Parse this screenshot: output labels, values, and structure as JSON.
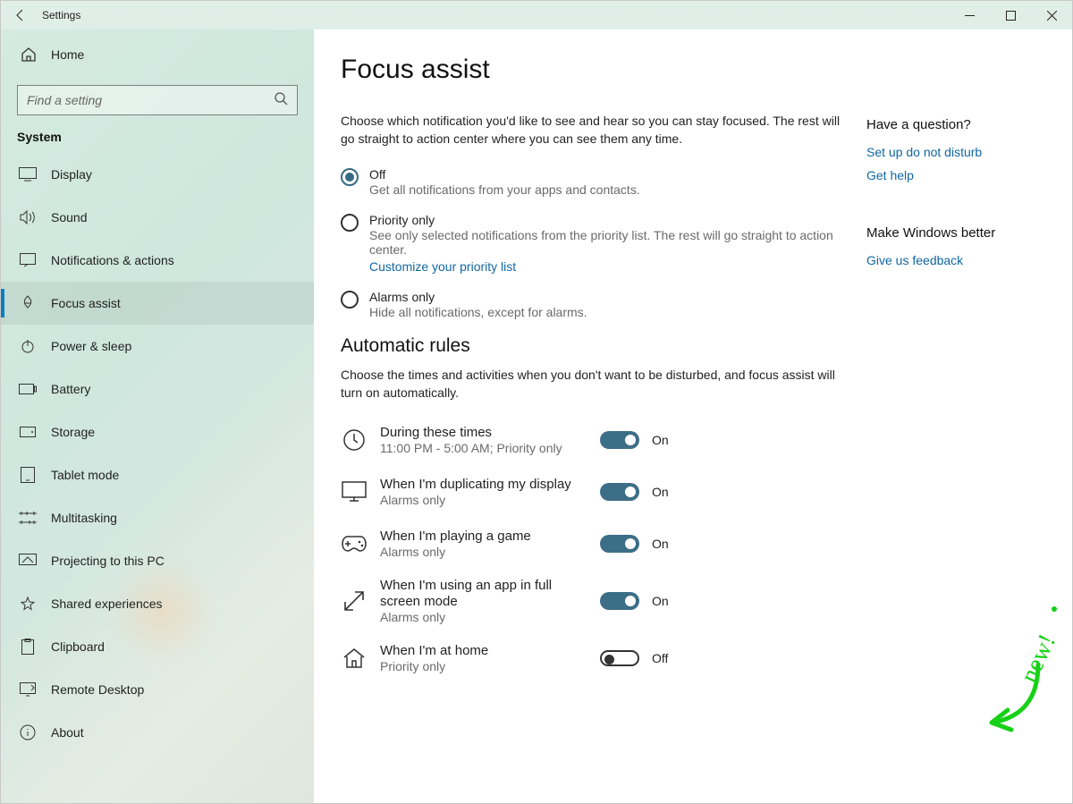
{
  "titlebar": {
    "title": "Settings"
  },
  "sidebar": {
    "home": "Home",
    "searchPlaceholder": "Find a setting",
    "section": "System",
    "items": [
      {
        "label": "Display"
      },
      {
        "label": "Sound"
      },
      {
        "label": "Notifications & actions"
      },
      {
        "label": "Focus assist"
      },
      {
        "label": "Power & sleep"
      },
      {
        "label": "Battery"
      },
      {
        "label": "Storage"
      },
      {
        "label": "Tablet mode"
      },
      {
        "label": "Multitasking"
      },
      {
        "label": "Projecting to this PC"
      },
      {
        "label": "Shared experiences"
      },
      {
        "label": "Clipboard"
      },
      {
        "label": "Remote Desktop"
      },
      {
        "label": "About"
      }
    ]
  },
  "page": {
    "heading": "Focus assist",
    "desc": "Choose which notification you'd like to see and hear so you can stay focused. The rest will go straight to action center where you can see them any time.",
    "options": [
      {
        "name": "Off",
        "sub": "Get all notifications from your apps and contacts."
      },
      {
        "name": "Priority only",
        "sub": "See only selected notifications from the priority list. The rest will go straight to action center.",
        "link": "Customize your priority list"
      },
      {
        "name": "Alarms only",
        "sub": "Hide all notifications, except for alarms."
      }
    ],
    "rulesHeading": "Automatic rules",
    "rulesDesc": "Choose the times and activities when you don't want to be disturbed, and focus assist will turn on automatically.",
    "rules": [
      {
        "title": "During these times",
        "sub": "11:00 PM - 5:00 AM; Priority only",
        "state": "On",
        "on": true
      },
      {
        "title": "When I'm duplicating my display",
        "sub": "Alarms only",
        "state": "On",
        "on": true
      },
      {
        "title": "When I'm playing a game",
        "sub": "Alarms only",
        "state": "On",
        "on": true
      },
      {
        "title": "When I'm using an app in full screen mode",
        "sub": "Alarms only",
        "state": "On",
        "on": true
      },
      {
        "title": "When I'm at home",
        "sub": "Priority only",
        "state": "Off",
        "on": false
      }
    ]
  },
  "aside": {
    "q": "Have a question?",
    "q_links": [
      "Set up do not disturb",
      "Get help"
    ],
    "w": "Make Windows better",
    "w_links": [
      "Give us feedback"
    ]
  },
  "annotation": "new!"
}
